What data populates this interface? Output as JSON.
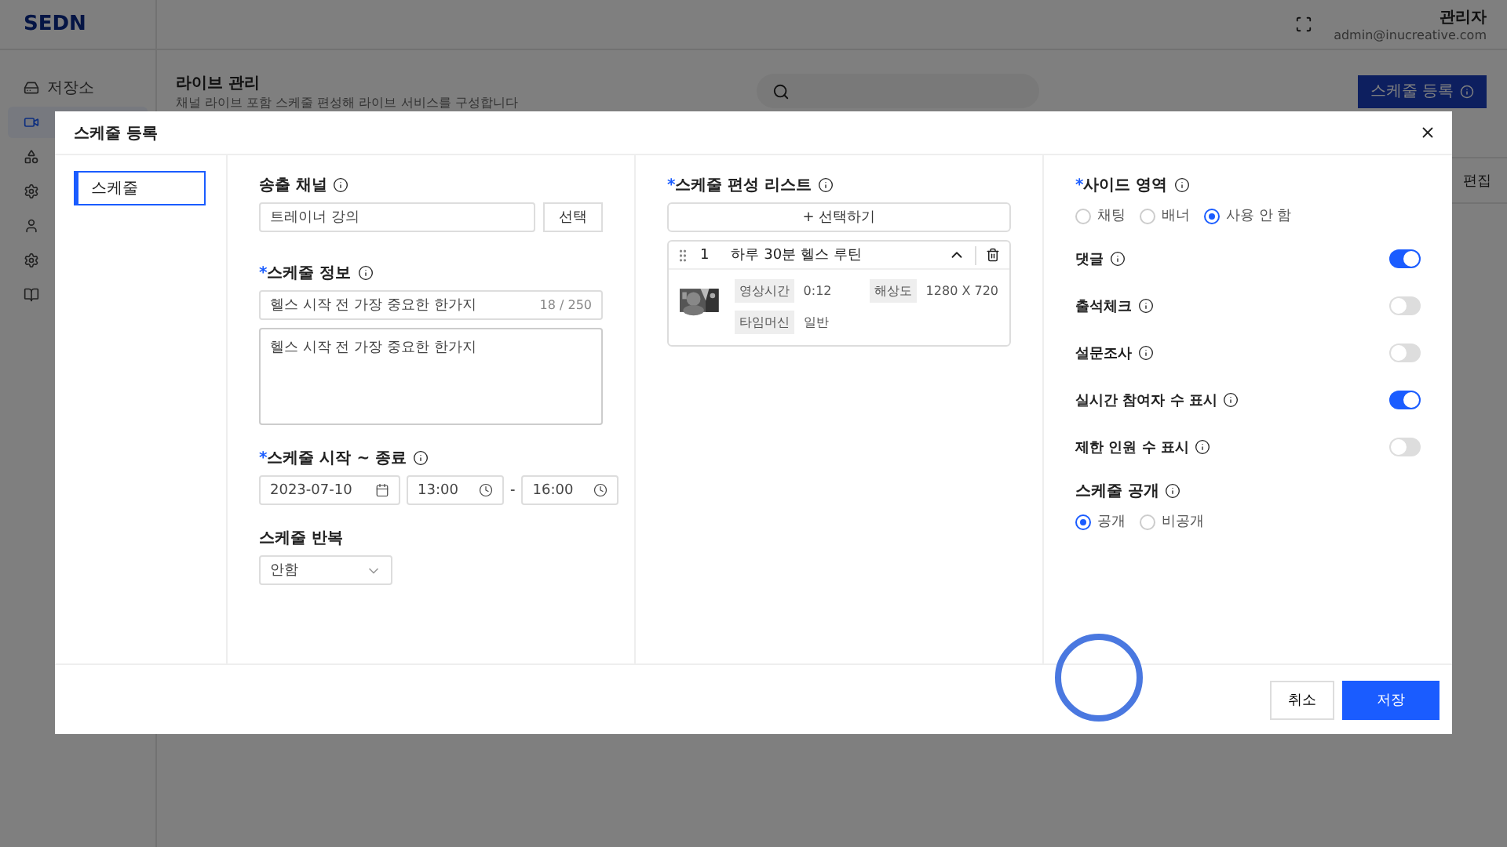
{
  "app": {
    "logo": "SEDN",
    "sidebar": [
      {
        "kind": "storage",
        "label": "저장소",
        "selected": false
      },
      {
        "kind": "live",
        "selected": true
      },
      {
        "kind": "shapes",
        "selected": false
      },
      {
        "kind": "gear",
        "selected": false
      },
      {
        "kind": "user",
        "selected": false
      },
      {
        "kind": "gear",
        "selected": false
      },
      {
        "kind": "book",
        "selected": false
      }
    ],
    "user": {
      "name": "관리자",
      "email": "admin@inucreative.com"
    },
    "page": {
      "title": "라이브 관리",
      "description": "채널 라이브 포함 스케줄 편성해 라이브 서비스를 구성합니다"
    },
    "register_button": "스케줄 등록",
    "table_column": "편집"
  },
  "modal": {
    "title": "스케줄 등록",
    "nav": [
      {
        "label": "스케줄",
        "selected": true
      }
    ],
    "channel": {
      "label": "송출 채널",
      "value": "트레이너 강의",
      "button": "선택"
    },
    "info": {
      "label": "스케줄 정보",
      "required_mark": "*",
      "title_value": "헬스 시작 전 가장 중요한 한가지",
      "counter": "18 / 250",
      "body_value": "헬스 시작 전 가장 중요한 한가지"
    },
    "period": {
      "label": "스케줄 시작 ~ 종료",
      "required_mark": "*",
      "date": "2023-07-10",
      "start": "13:00",
      "separator": "-",
      "end": "16:00"
    },
    "repeat": {
      "label": "스케줄 반복",
      "value": "안함"
    },
    "list": {
      "label": "스케줄 편성 리스트",
      "required_mark": "*",
      "add_button": "+ 선택하기",
      "items": [
        {
          "index": "1",
          "title": "하루 30분 헬스 루틴",
          "expanded": true,
          "meta": [
            {
              "key": "영상시간",
              "value": "0:12"
            },
            {
              "key": "해상도",
              "value": "1280 X 720"
            },
            {
              "key": "타임머신",
              "value": "일반"
            }
          ]
        }
      ]
    },
    "side": {
      "label": "사이드 영역",
      "required_mark": "*",
      "options": [
        {
          "label": "채팅",
          "selected": false
        },
        {
          "label": "배너",
          "selected": false
        },
        {
          "label": "사용 안 함",
          "selected": true
        }
      ]
    },
    "toggles": [
      {
        "label": "댓글",
        "on": true
      },
      {
        "label": "출석체크",
        "on": false
      },
      {
        "label": "설문조사",
        "on": false
      },
      {
        "label": "실시간 참여자 수 표시",
        "on": true
      },
      {
        "label": "제한 인원 수 표시",
        "on": false
      }
    ],
    "visibility": {
      "label": "스케줄 공개",
      "options": [
        {
          "label": "공개",
          "selected": true
        },
        {
          "label": "비공개",
          "selected": false
        }
      ]
    },
    "cancel_button": "취소",
    "save_button": "저장"
  }
}
